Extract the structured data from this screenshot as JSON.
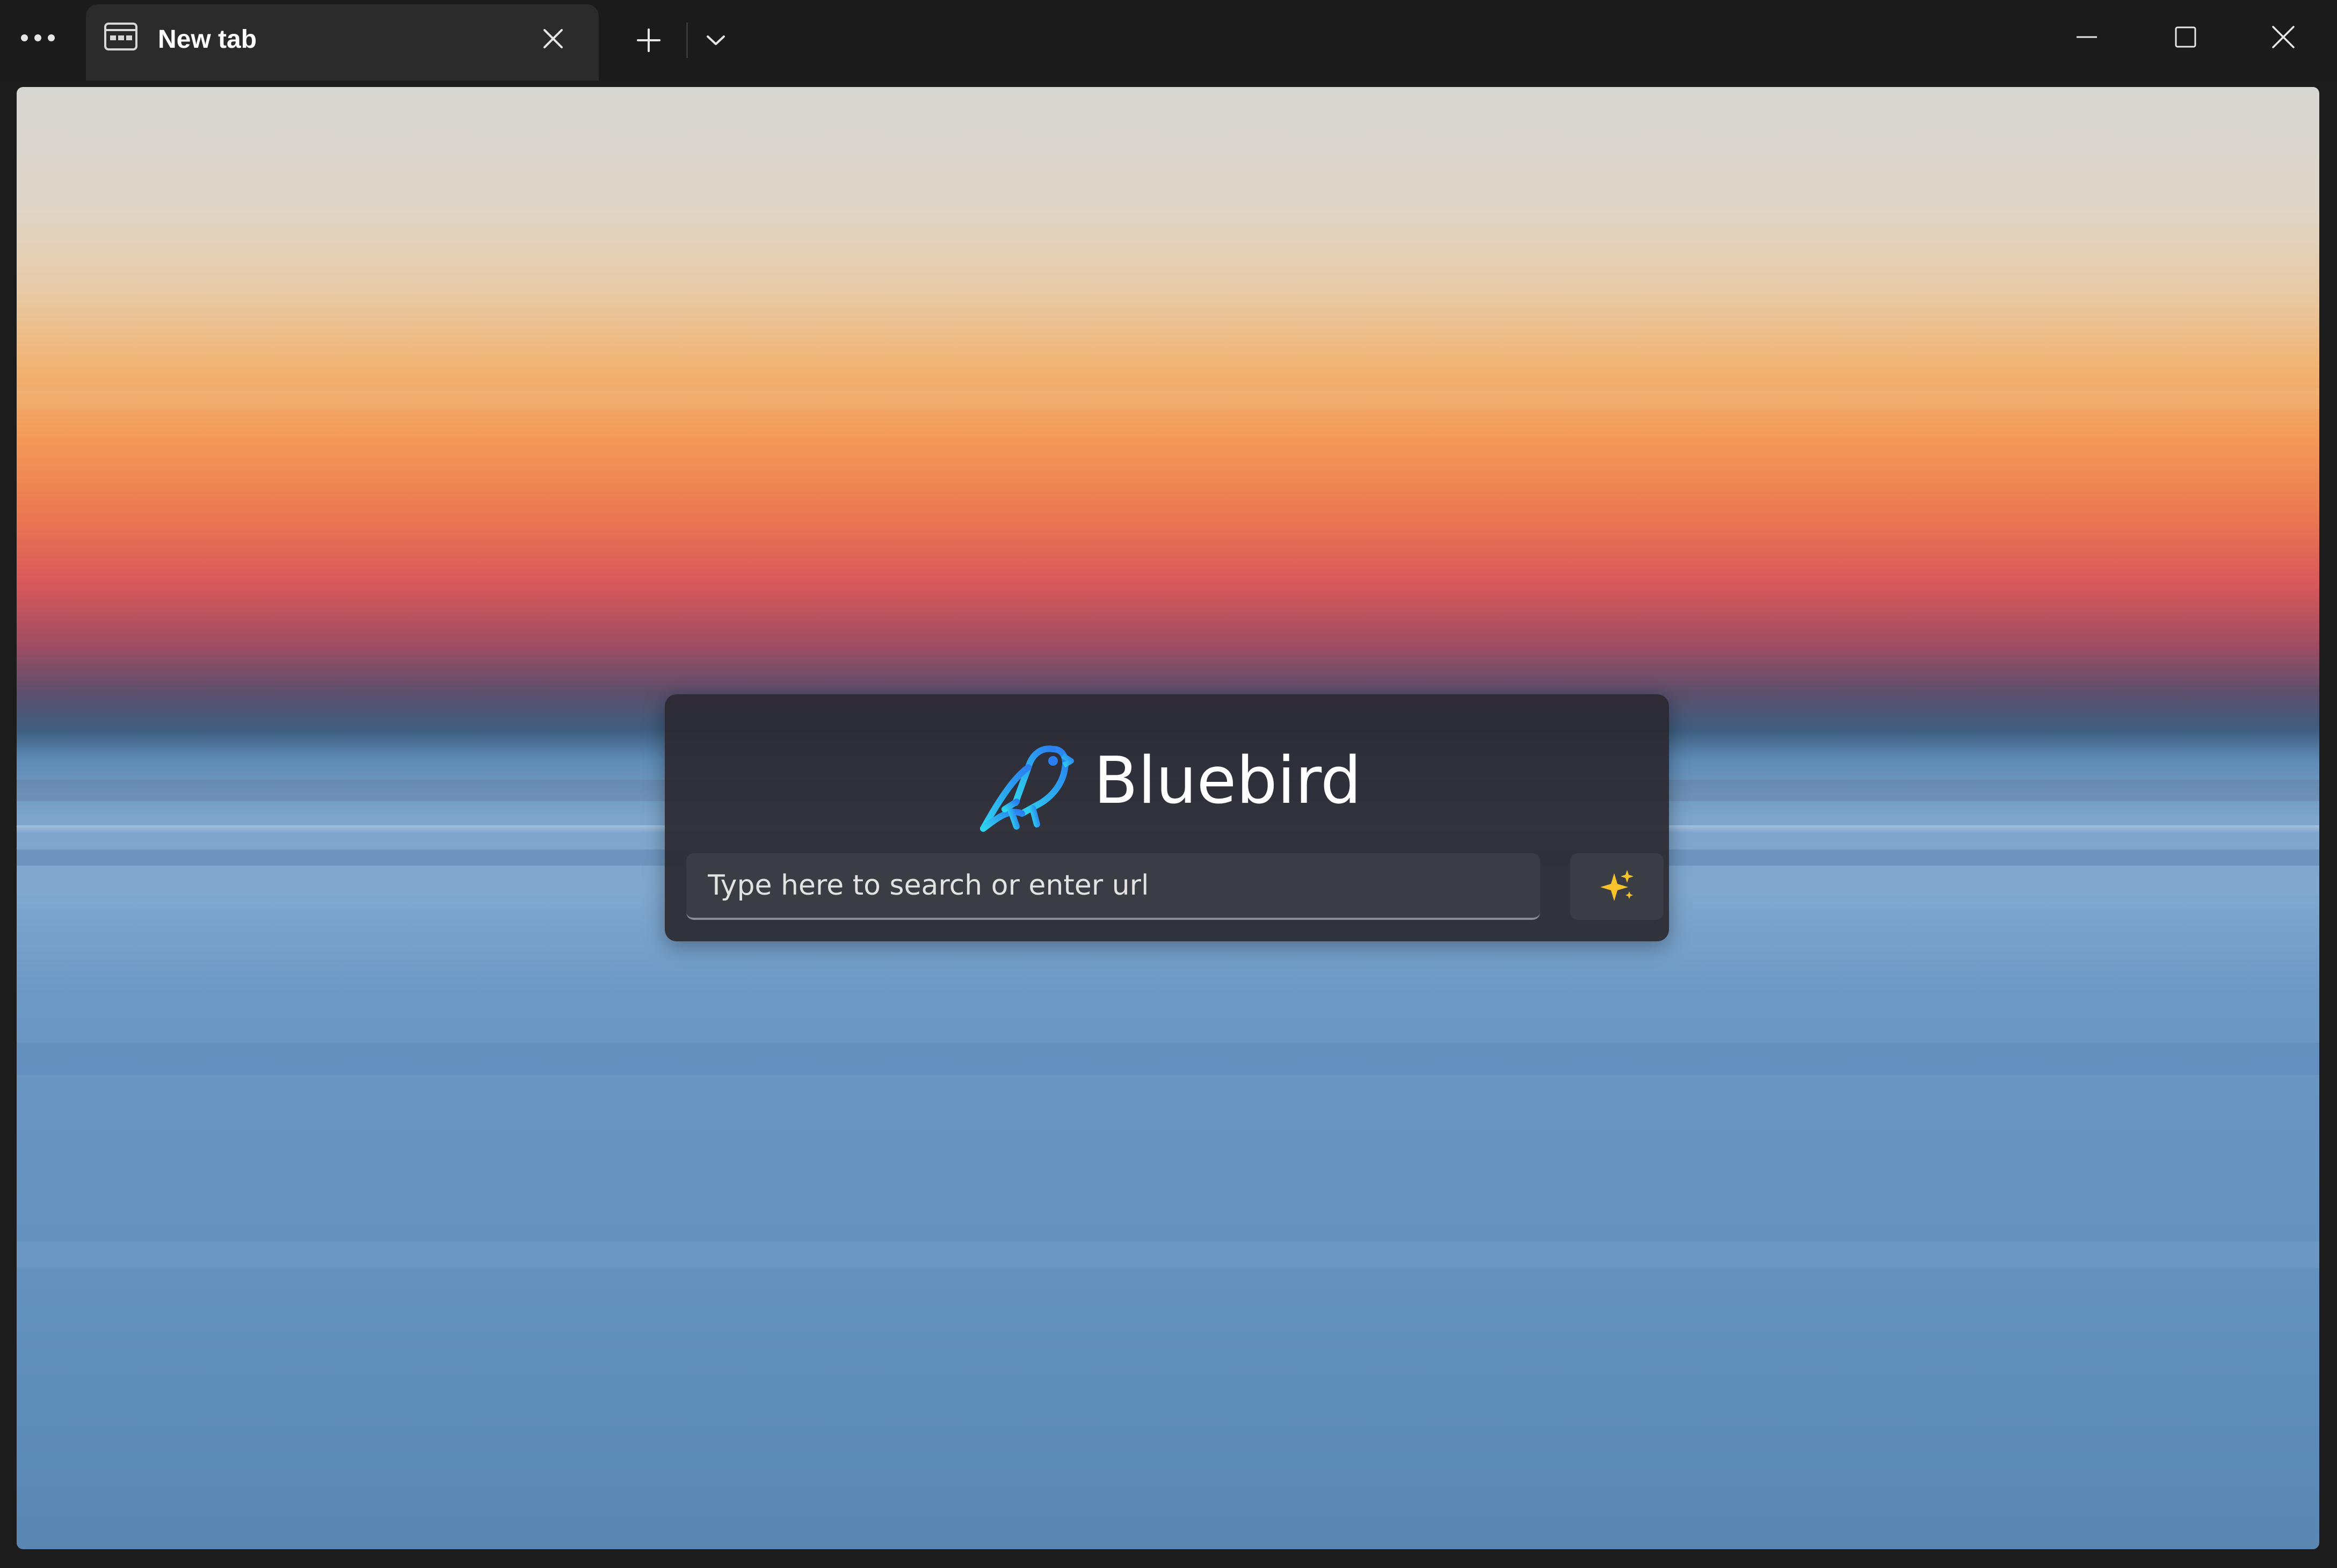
{
  "window": {
    "menu_icon": "more-dots-icon",
    "controls": {
      "minimize_icon": "minimize-icon",
      "maximize_icon": "maximize-icon",
      "close_icon": "close-icon"
    }
  },
  "tabs": [
    {
      "title": "New tab",
      "icon": "new-tab-page-icon",
      "active": true
    }
  ],
  "tabbar": {
    "new_tab_icon": "plus-icon",
    "tab_list_icon": "chevron-down-icon"
  },
  "start_page": {
    "brand_name": "Bluebird",
    "brand_icon": "bluebird-logo",
    "search": {
      "placeholder": "Type here to search or enter url",
      "value": ""
    },
    "ai_button_icon": "sparkle-icon",
    "colors": {
      "accent_logo_start": "#2fd4ee",
      "accent_logo_end": "#2a7ff0",
      "sparkle": "#f7c22c"
    }
  }
}
